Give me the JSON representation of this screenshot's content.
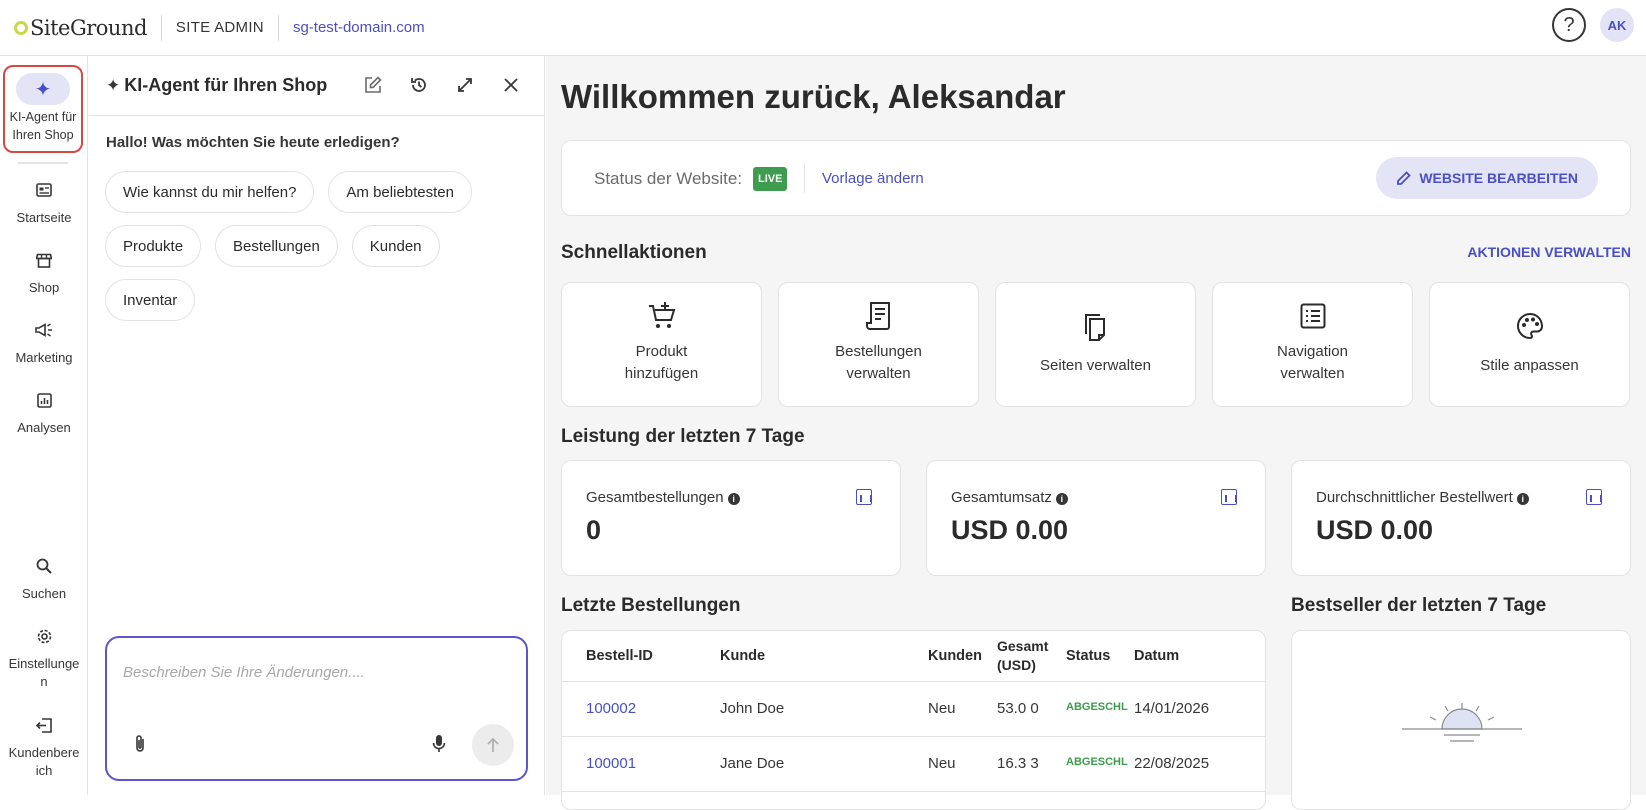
{
  "topbar": {
    "logo": "SiteGround",
    "site_admin": "SITE ADMIN",
    "domain": "sg-test-domain.com",
    "help": "?",
    "avatar": "AK"
  },
  "leftnav": {
    "ai_agent": "KI-Agent für Ihren Shop",
    "items": [
      {
        "label": "Startseite",
        "icon": "home-icon"
      },
      {
        "label": "Shop",
        "icon": "store-icon"
      },
      {
        "label": "Marketing",
        "icon": "megaphone-icon"
      },
      {
        "label": "Analysen",
        "icon": "analytics-icon"
      },
      {
        "label": "Suchen",
        "icon": "search-icon"
      },
      {
        "label": "Einstellunge n",
        "icon": "gear-icon"
      },
      {
        "label": "Kundenbere ich",
        "icon": "logout-icon"
      }
    ]
  },
  "chat": {
    "title": "KI-Agent für Ihren Shop",
    "greeting": "Hallo! Was möchten Sie heute erledigen?",
    "chips": [
      "Wie kannst du mir helfen?",
      "Am beliebtesten",
      "Produkte",
      "Bestellungen",
      "Kunden",
      "Inventar"
    ],
    "placeholder": "Beschreiben Sie Ihre Änderungen...."
  },
  "main": {
    "welcome": "Willkommen zurück, Aleksandar",
    "status_label": "Status der Website:",
    "live": "LIVE",
    "template_link": "Vorlage ändern",
    "edit_button": "WEBSITE BEARBEITEN",
    "quick_actions_title": "Schnellaktionen",
    "manage_actions": "AKTIONEN VERWALTEN",
    "quick_actions": [
      {
        "label": "Produkt hinzufügen",
        "icon": "cart-add-icon"
      },
      {
        "label": "Bestellungen verwalten",
        "icon": "receipt-icon"
      },
      {
        "label": "Seiten verwalten",
        "icon": "pages-icon"
      },
      {
        "label": "Navigation verwalten",
        "icon": "list-icon"
      },
      {
        "label": "Stile anpassen",
        "icon": "palette-icon"
      }
    ],
    "performance_title": "Leistung der letzten 7 Tage",
    "metrics": [
      {
        "label": "Gesamtbestellungen",
        "value": "0"
      },
      {
        "label": "Gesamtumsatz",
        "value": "USD 0.00"
      },
      {
        "label": "Durchschnittlicher Bestellwert",
        "value": "USD 0.00"
      }
    ],
    "orders_title": "Letzte Bestellungen",
    "orders_headers": [
      "Bestell-ID",
      "Kunde",
      "Kunden",
      "Gesamt (USD)",
      "Status",
      "Datum"
    ],
    "orders": [
      {
        "id": "100002",
        "customer": "John Doe",
        "type": "Neu",
        "total": "53.0 0",
        "status": "ABGESCHLOSSEN",
        "date": "14/01/2026"
      },
      {
        "id": "100001",
        "customer": "Jane Doe",
        "type": "Neu",
        "total": "16.3 3",
        "status": "ABGESCHLOSSEN",
        "date": "22/08/2025"
      }
    ],
    "bestseller_title": "Bestseller der letzten 7 Tage"
  }
}
